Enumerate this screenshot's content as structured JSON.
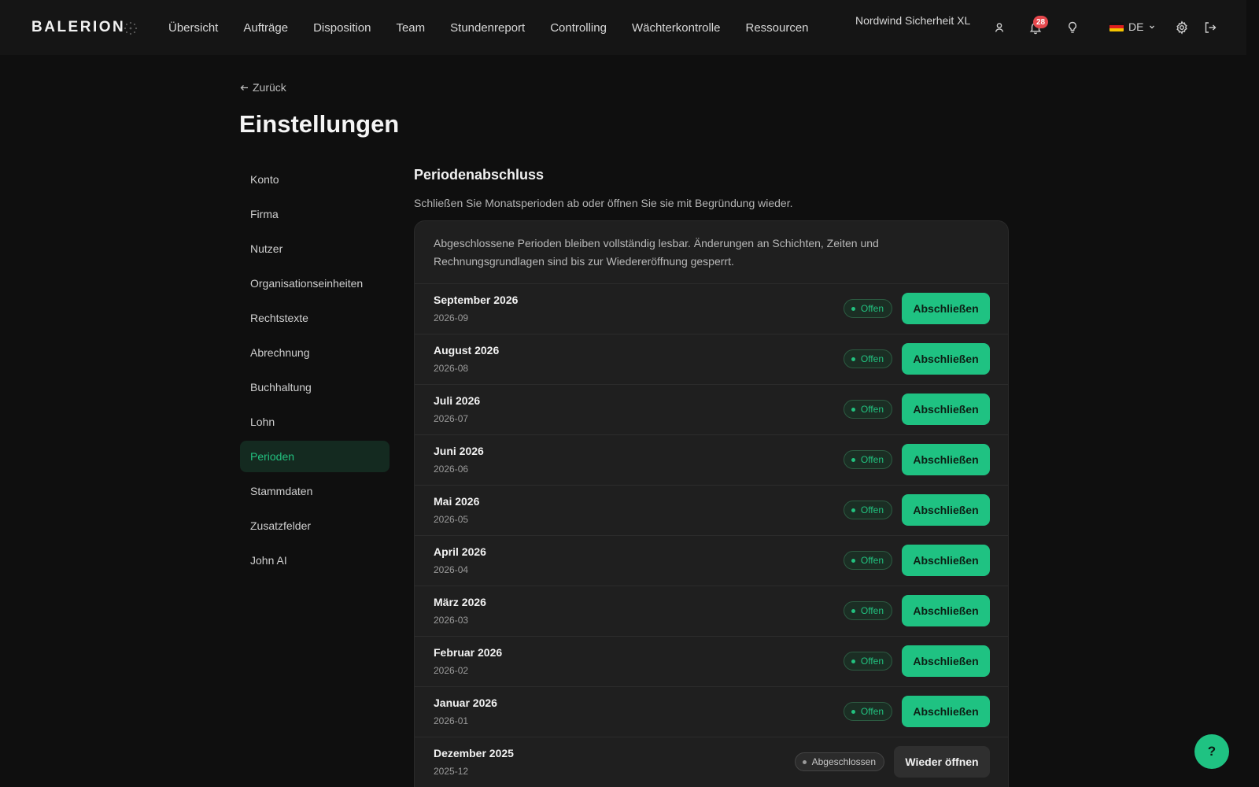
{
  "app": {
    "logo": "BALERION"
  },
  "nav": {
    "items": [
      "Übersicht",
      "Aufträge",
      "Disposition",
      "Team",
      "Stundenreport",
      "Controlling",
      "Wächterkontrolle",
      "Ressourcen"
    ]
  },
  "header": {
    "company": "Nordwind Sicherheit XL",
    "notification_count": "28",
    "language": "DE"
  },
  "page": {
    "back_label": "Zurück",
    "title": "Einstellungen"
  },
  "sidebar": {
    "items": [
      "Konto",
      "Firma",
      "Nutzer",
      "Organisationseinheiten",
      "Rechtstexte",
      "Abrechnung",
      "Buchhaltung",
      "Lohn",
      "Perioden",
      "Stammdaten",
      "Zusatzfelder",
      "John AI"
    ],
    "active": "Perioden"
  },
  "section": {
    "title": "Periodenabschluss",
    "description": "Schließen Sie Monatsperioden ab oder öffnen Sie sie mit Begründung wieder.",
    "note_line1": "Abgeschlossene Perioden bleiben vollständig lesbar. Änderungen an Schichten, Zeiten und",
    "note_line2": "Rechnungsgrundlagen sind bis zur Wiedereröffnung gesperrt."
  },
  "periods": [
    {
      "name": "September 2026",
      "code": "2026-09",
      "status": "Offen",
      "action": "Abschließen"
    },
    {
      "name": "August 2026",
      "code": "2026-08",
      "status": "Offen",
      "action": "Abschließen"
    },
    {
      "name": "Juli 2026",
      "code": "2026-07",
      "status": "Offen",
      "action": "Abschließen"
    },
    {
      "name": "Juni 2026",
      "code": "2026-06",
      "status": "Offen",
      "action": "Abschließen"
    },
    {
      "name": "Mai 2026",
      "code": "2026-05",
      "status": "Offen",
      "action": "Abschließen"
    },
    {
      "name": "April 2026",
      "code": "2026-04",
      "status": "Offen",
      "action": "Abschließen"
    },
    {
      "name": "März 2026",
      "code": "2026-03",
      "status": "Offen",
      "action": "Abschließen"
    },
    {
      "name": "Februar 2026",
      "code": "2026-02",
      "status": "Offen",
      "action": "Abschließen"
    },
    {
      "name": "Januar 2026",
      "code": "2026-01",
      "status": "Offen",
      "action": "Abschließen"
    },
    {
      "name": "Dezember 2025",
      "code": "2025-12",
      "status": "Abgeschlossen",
      "action": "Wieder öffnen"
    }
  ],
  "help": {
    "label": "?"
  },
  "colors": {
    "accent": "#1fc282",
    "background": "#0f0f0f",
    "card": "#1f1f1f",
    "badge": "#e5484d"
  },
  "icons": [
    "user-icon",
    "bell-icon",
    "lightbulb-icon",
    "chevron-down-icon",
    "gear-icon",
    "logout-icon",
    "arrow-left-icon"
  ]
}
